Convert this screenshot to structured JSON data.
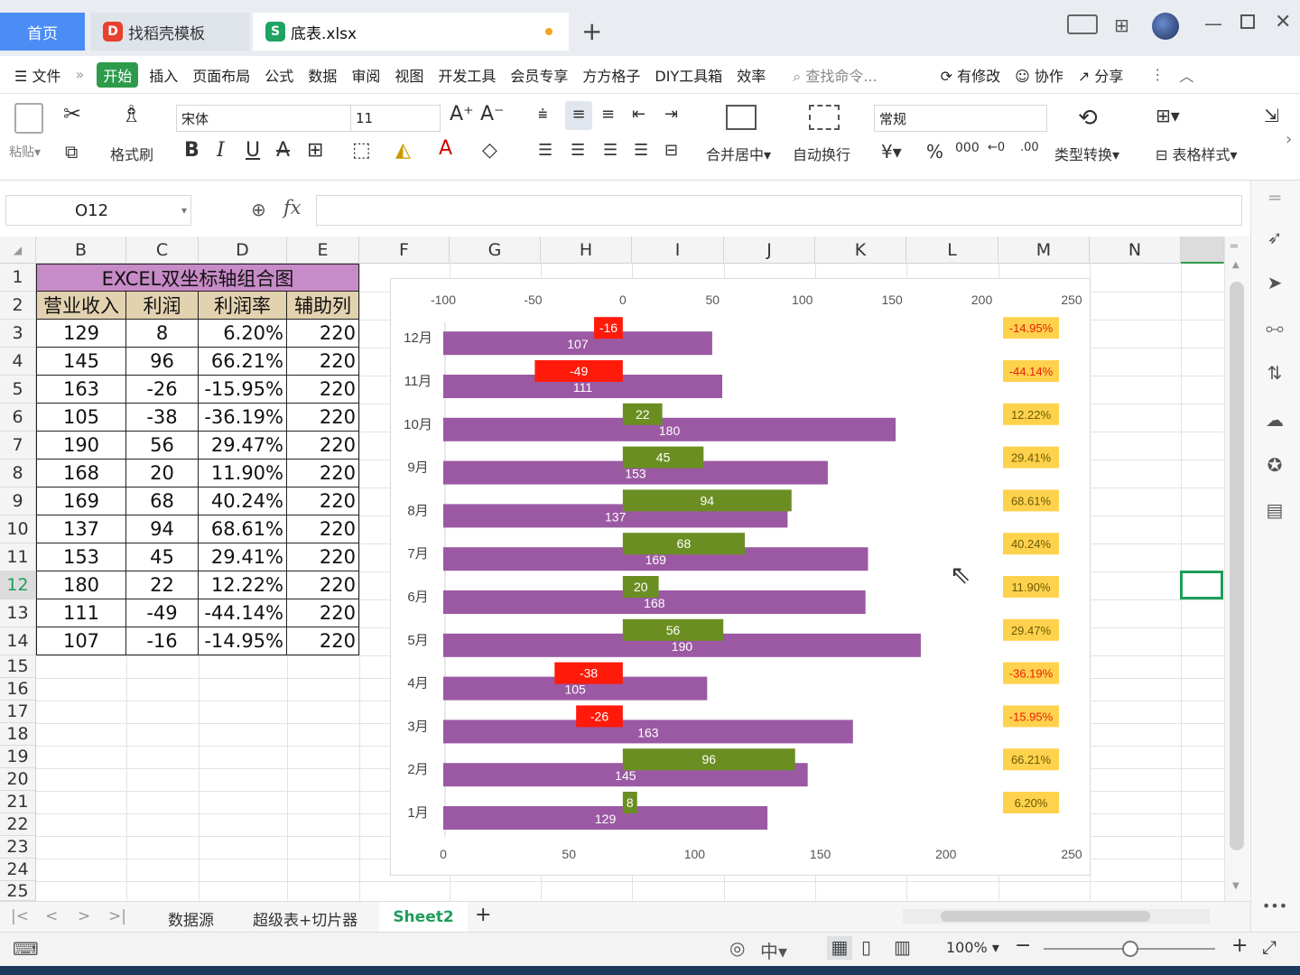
{
  "titlebar": {
    "tabs": [
      {
        "label": "首页"
      },
      {
        "label": "找稻壳模板"
      },
      {
        "label": "底表.xlsx"
      }
    ]
  },
  "menubar": {
    "file": "文件",
    "items": [
      "开始",
      "插入",
      "页面布局",
      "公式",
      "数据",
      "审阅",
      "视图",
      "开发工具",
      "会员专享",
      "方方格子",
      "DIY工具箱",
      "效率"
    ],
    "search": "查找命令...",
    "has_changes": "有修改",
    "collab": "协作",
    "share": "分享"
  },
  "ribbon": {
    "paste": "粘贴",
    "format_painter": "格式刷",
    "font": "宋体",
    "font_size": "11",
    "merge": "合并居中",
    "wrap": "自动换行",
    "number_format": "常规",
    "type_convert": "类型转换",
    "table_style": "表格样式"
  },
  "formula_bar": {
    "cell_ref": "O12",
    "fx": "fx"
  },
  "columns": [
    "B",
    "C",
    "D",
    "E",
    "F",
    "G",
    "H",
    "I",
    "J",
    "K",
    "L",
    "M",
    "N"
  ],
  "rows": [
    "1",
    "2",
    "3",
    "4",
    "5",
    "6",
    "7",
    "8",
    "9",
    "10",
    "11",
    "12",
    "13",
    "14",
    "15",
    "16",
    "17",
    "18",
    "19",
    "20",
    "21",
    "22",
    "23",
    "24",
    "25"
  ],
  "table": {
    "title": "EXCEL双坐标轴组合图",
    "headers": [
      "营业收入",
      "利润",
      "利润率",
      "辅助列"
    ],
    "data": [
      [
        "129",
        "8",
        "6.20%",
        "220"
      ],
      [
        "145",
        "96",
        "66.21%",
        "220"
      ],
      [
        "163",
        "-26",
        "-15.95%",
        "220"
      ],
      [
        "105",
        "-38",
        "-36.19%",
        "220"
      ],
      [
        "190",
        "56",
        "29.47%",
        "220"
      ],
      [
        "168",
        "20",
        "11.90%",
        "220"
      ],
      [
        "169",
        "68",
        "40.24%",
        "220"
      ],
      [
        "137",
        "94",
        "68.61%",
        "220"
      ],
      [
        "153",
        "45",
        "29.41%",
        "220"
      ],
      [
        "180",
        "22",
        "12.22%",
        "220"
      ],
      [
        "111",
        "-49",
        "-44.14%",
        "220"
      ],
      [
        "107",
        "-16",
        "-14.95%",
        "220"
      ]
    ]
  },
  "chart_data": {
    "type": "bar",
    "categories": [
      "1月",
      "2月",
      "3月",
      "4月",
      "5月",
      "6月",
      "7月",
      "8月",
      "9月",
      "10月",
      "11月",
      "12月"
    ],
    "series": [
      {
        "name": "营业收入",
        "values": [
          129,
          145,
          163,
          105,
          190,
          168,
          169,
          137,
          153,
          180,
          111,
          107
        ],
        "color": "#9b59a3"
      },
      {
        "name": "利润",
        "values": [
          8,
          96,
          -26,
          -38,
          56,
          20,
          68,
          94,
          45,
          22,
          -49,
          -16
        ],
        "color_pos": "#6b8e23",
        "color_neg": "#ff1a0a"
      },
      {
        "name": "利润率",
        "values": [
          "6.20%",
          "66.21%",
          "-15.95%",
          "-36.19%",
          "29.47%",
          "11.90%",
          "40.24%",
          "68.61%",
          "29.41%",
          "12.22%",
          "-44.14%",
          "-14.95%"
        ],
        "color": "#ffd24d"
      }
    ],
    "top_axis": {
      "ticks": [
        "-100",
        "-50",
        "0",
        "50",
        "100",
        "150",
        "200",
        "250"
      ],
      "range": [
        -100,
        250
      ]
    },
    "bottom_axis": {
      "ticks": [
        "0",
        "50",
        "100",
        "150",
        "200",
        "250"
      ],
      "range": [
        0,
        250
      ]
    }
  },
  "sheets": {
    "tabs": [
      "数据源",
      "超级表+切片器",
      "Sheet2"
    ],
    "active": "Sheet2"
  },
  "status": {
    "zoom": "100%"
  }
}
